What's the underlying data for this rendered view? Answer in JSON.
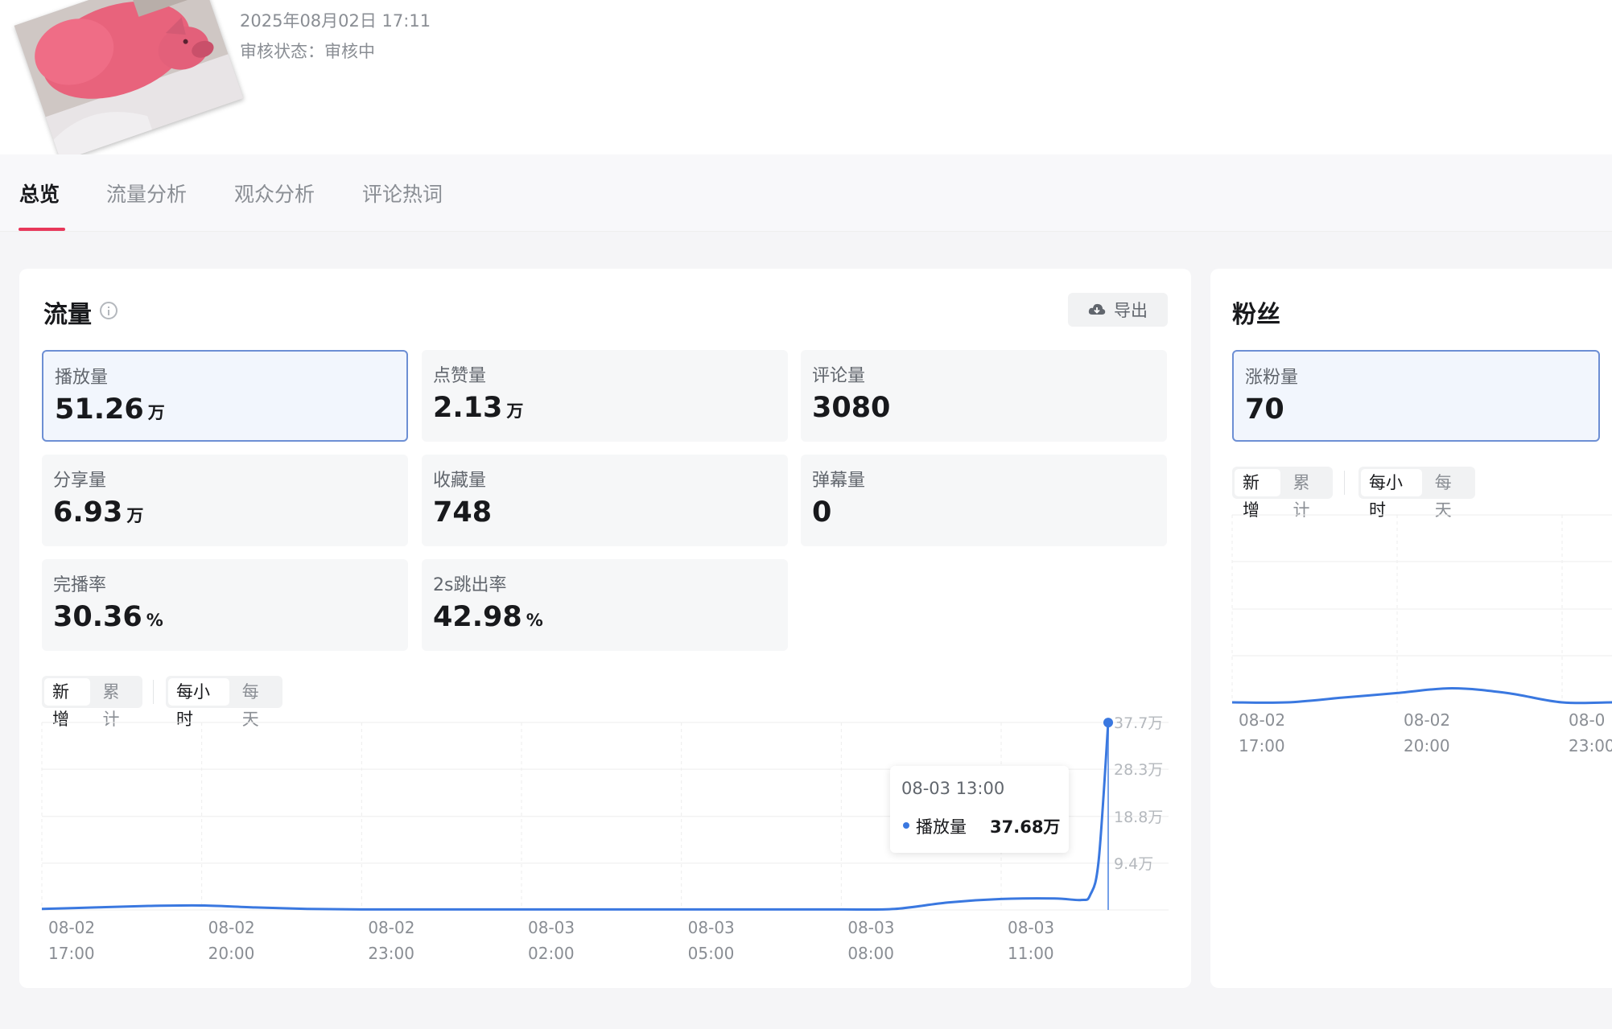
{
  "header": {
    "publish_time": "2025年08月02日 17:11",
    "status_label": "审核状态：",
    "status_value": "审核中"
  },
  "tabs": [
    {
      "label": "总览",
      "active": true
    },
    {
      "label": "流量分析",
      "active": false
    },
    {
      "label": "观众分析",
      "active": false
    },
    {
      "label": "评论热词",
      "active": false
    }
  ],
  "traffic": {
    "title": "流量",
    "export_label": "导出",
    "metrics": [
      {
        "label": "播放量",
        "value": "51.26",
        "unit": "万",
        "selected": true
      },
      {
        "label": "点赞量",
        "value": "2.13",
        "unit": "万",
        "selected": false
      },
      {
        "label": "评论量",
        "value": "3080",
        "unit": "",
        "selected": false
      },
      {
        "label": "分享量",
        "value": "6.93",
        "unit": "万",
        "selected": false
      },
      {
        "label": "收藏量",
        "value": "748",
        "unit": "",
        "selected": false
      },
      {
        "label": "弹幕量",
        "value": "0",
        "unit": "",
        "selected": false
      },
      {
        "label": "完播率",
        "value": "30.36",
        "unit": "%",
        "selected": false
      },
      {
        "label": "2s跳出率",
        "value": "42.98",
        "unit": "%",
        "selected": false
      }
    ],
    "mode_toggle": [
      {
        "label": "新增",
        "active": true
      },
      {
        "label": "累计",
        "active": false
      }
    ],
    "interval_toggle": [
      {
        "label": "每小时",
        "active": true
      },
      {
        "label": "每天",
        "active": false
      }
    ],
    "tooltip": {
      "time": "08-03 13:00",
      "series": "播放量",
      "value": "37.68万"
    }
  },
  "fans": {
    "title": "粉丝",
    "metric": {
      "label": "涨粉量",
      "value": "70",
      "selected": true
    },
    "mode_toggle": [
      {
        "label": "新增",
        "active": true
      },
      {
        "label": "累计",
        "active": false
      }
    ],
    "interval_toggle": [
      {
        "label": "每小时",
        "active": true
      },
      {
        "label": "每天",
        "active": false
      }
    ]
  },
  "colors": {
    "accent": "#e8375a",
    "line": "#3a78e0",
    "selected_border": "#6d8fd4",
    "selected_bg": "#f2f6fd"
  },
  "chart_data": [
    {
      "type": "line",
      "series": [
        {
          "name": "播放量",
          "values": [
            0.2,
            0.5,
            0.8,
            0.9,
            0.5,
            0.2,
            0.1,
            0.1,
            0.1,
            0.1,
            0.1,
            0.1,
            0.1,
            0.1,
            0.1,
            0.1,
            0.2,
            1.5,
            2.2,
            2.3,
            2.0,
            3.0,
            10.0,
            37.68
          ]
        }
      ],
      "x": [
        "08-02 17:00",
        "08-02 18:00",
        "08-02 19:00",
        "08-02 20:00",
        "08-02 21:00",
        "08-02 22:00",
        "08-02 23:00",
        "08-03 00:00",
        "08-03 01:00",
        "08-03 02:00",
        "08-03 03:00",
        "08-03 04:00",
        "08-03 05:00",
        "08-03 06:00",
        "08-03 07:00",
        "08-03 08:00",
        "08-03 09:00",
        "08-03 10:00",
        "08-03 11:00",
        "08-03 12:00",
        "08-03 12:30",
        "08-03 12:40",
        "08-03 12:50",
        "08-03 13:00"
      ],
      "xticks": [
        {
          "top": "08-02",
          "bottom": "17:00"
        },
        {
          "top": "08-02",
          "bottom": "20:00"
        },
        {
          "top": "08-02",
          "bottom": "23:00"
        },
        {
          "top": "08-03",
          "bottom": "02:00"
        },
        {
          "top": "08-03",
          "bottom": "05:00"
        },
        {
          "top": "08-03",
          "bottom": "08:00"
        },
        {
          "top": "08-03",
          "bottom": "11:00"
        }
      ],
      "yticks": [
        "9.4万",
        "18.8万",
        "28.3万",
        "37.7万"
      ],
      "ylim": [
        0,
        37.7
      ],
      "unit": "万",
      "grid": true
    },
    {
      "type": "line",
      "series": [
        {
          "name": "涨粉量",
          "values": [
            0,
            0,
            1,
            2,
            3,
            2,
            0,
            0,
            0,
            0
          ]
        }
      ],
      "x": [
        "08-02 17:00",
        "08-02 18:00",
        "08-02 19:00",
        "08-02 20:00",
        "08-02 21:00",
        "08-02 22:00",
        "08-02 23:00",
        "08-03 00:00",
        "08-03 01:00",
        "08-03 02:00"
      ],
      "xticks": [
        {
          "top": "08-02",
          "bottom": "17:00"
        },
        {
          "top": "08-02",
          "bottom": "20:00"
        },
        {
          "top": "08-0",
          "bottom": "23:00"
        }
      ],
      "grid": true
    }
  ]
}
